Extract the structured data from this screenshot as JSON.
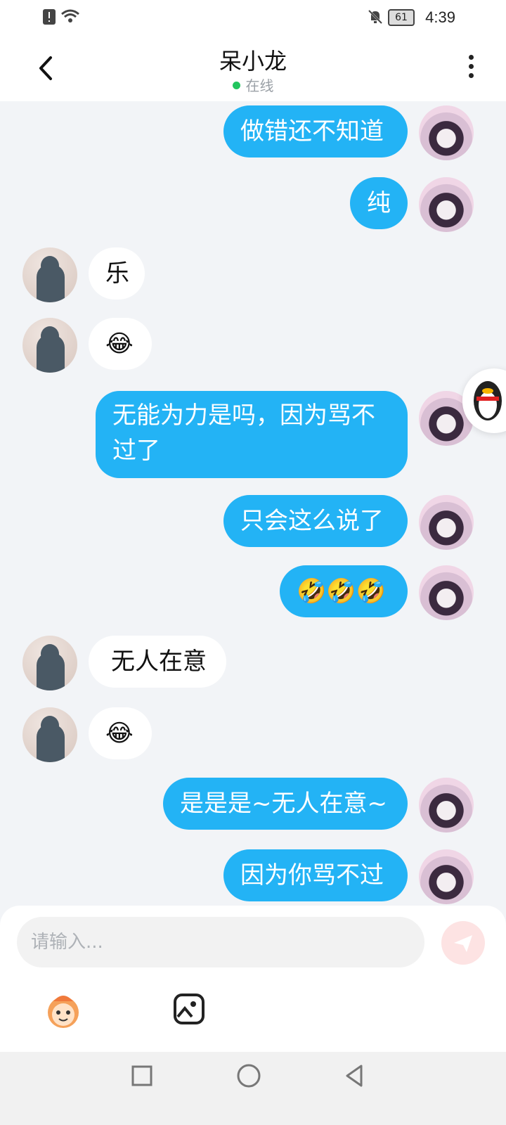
{
  "status": {
    "time": "4:39",
    "battery": "61"
  },
  "header": {
    "title": "呆小龙",
    "status": "在线"
  },
  "messages": [
    {
      "side": "me",
      "text": "做错还不知道"
    },
    {
      "side": "me",
      "text": "纯"
    },
    {
      "side": "them",
      "text": "乐"
    },
    {
      "side": "them",
      "text": "😂"
    },
    {
      "side": "me",
      "text": "无能为力是吗，因为骂不过了"
    },
    {
      "side": "me",
      "text": "只会这么说了"
    },
    {
      "side": "me",
      "text": "🤣🤣🤣"
    },
    {
      "side": "them",
      "text": "无人在意"
    },
    {
      "side": "them",
      "text": "😂"
    },
    {
      "side": "me",
      "text": "是是是~无人在意~"
    },
    {
      "side": "me",
      "text": "因为你骂不过"
    }
  ],
  "input": {
    "placeholder": "请输入..."
  },
  "icons": {
    "back": "back-arrow-icon",
    "more": "more-vert-icon",
    "send": "send-icon",
    "emoji": "emoji-face-icon",
    "image": "image-icon"
  }
}
